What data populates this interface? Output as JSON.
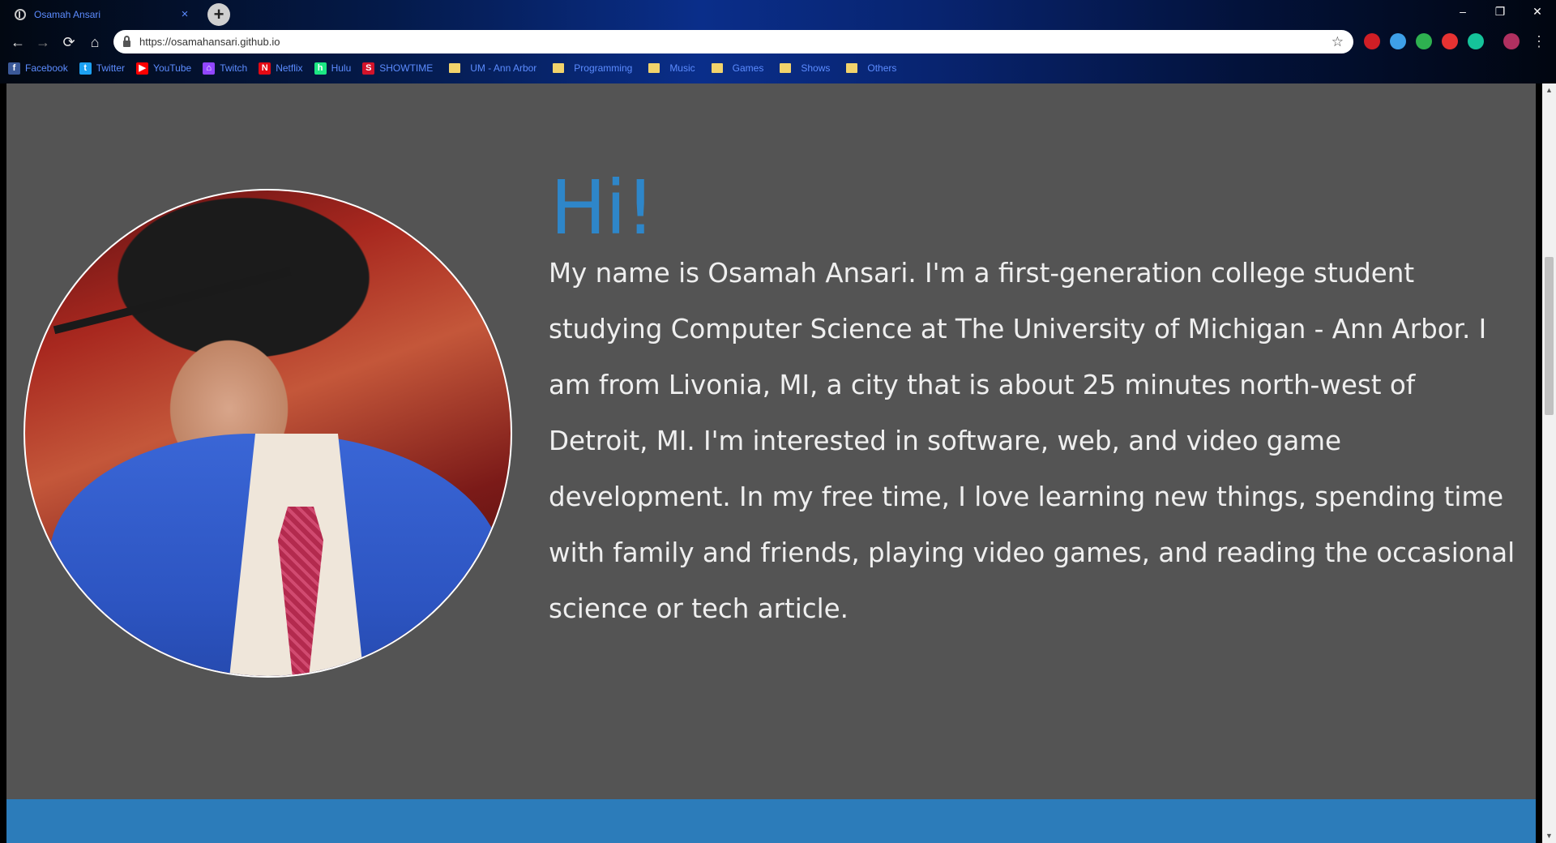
{
  "browser": {
    "tab_title": "Osamah Ansari",
    "tab_close": "×",
    "new_tab": "+",
    "window_controls": {
      "minimize": "–",
      "restore": "❐",
      "close": "✕"
    },
    "nav": {
      "back": "←",
      "forward": "→",
      "reload": "⟳",
      "home": "⌂"
    },
    "url": "https://osamahansari.github.io",
    "star": "☆",
    "extensions": [
      "#d01e25",
      "#3ea0e8",
      "#2eb150",
      "#e63232",
      "#15c39a",
      "#b03060"
    ],
    "menu": "⋮"
  },
  "bookmarks": [
    {
      "label": "Facebook",
      "icon": "f",
      "color": "#3b5998"
    },
    {
      "label": "Twitter",
      "icon": "t",
      "color": "#1da1f2"
    },
    {
      "label": "YouTube",
      "icon": "▶",
      "color": "#ff0000"
    },
    {
      "label": "Twitch",
      "icon": "⌂",
      "color": "#9146ff"
    },
    {
      "label": "Netflix",
      "icon": "N",
      "color": "#e50914"
    },
    {
      "label": "Hulu",
      "icon": "h",
      "color": "#1ce783"
    },
    {
      "label": "SHOWTIME",
      "icon": "S",
      "color": "#d3132a"
    }
  ],
  "bookmark_folders": [
    "UM - Ann Arbor",
    "Programming",
    "Music",
    "Games",
    "Shows",
    "Others"
  ],
  "page": {
    "headline": "Hi!",
    "bio": "My name is Osamah Ansari. I'm a first-generation college student studying Computer Science at The University of Michigan - Ann Arbor. I am from Livonia, MI, a city that is about 25 minutes north-west of Detroit, MI. I'm interested in software, web, and video game development. In my free time, I love learning new things, spending time with family and friends, playing video games, and reading the occasional science or tech article.",
    "accent_color": "#2e86c9",
    "background_color": "#545454"
  },
  "scrollbar": {
    "up": "▲",
    "down": "▼"
  }
}
